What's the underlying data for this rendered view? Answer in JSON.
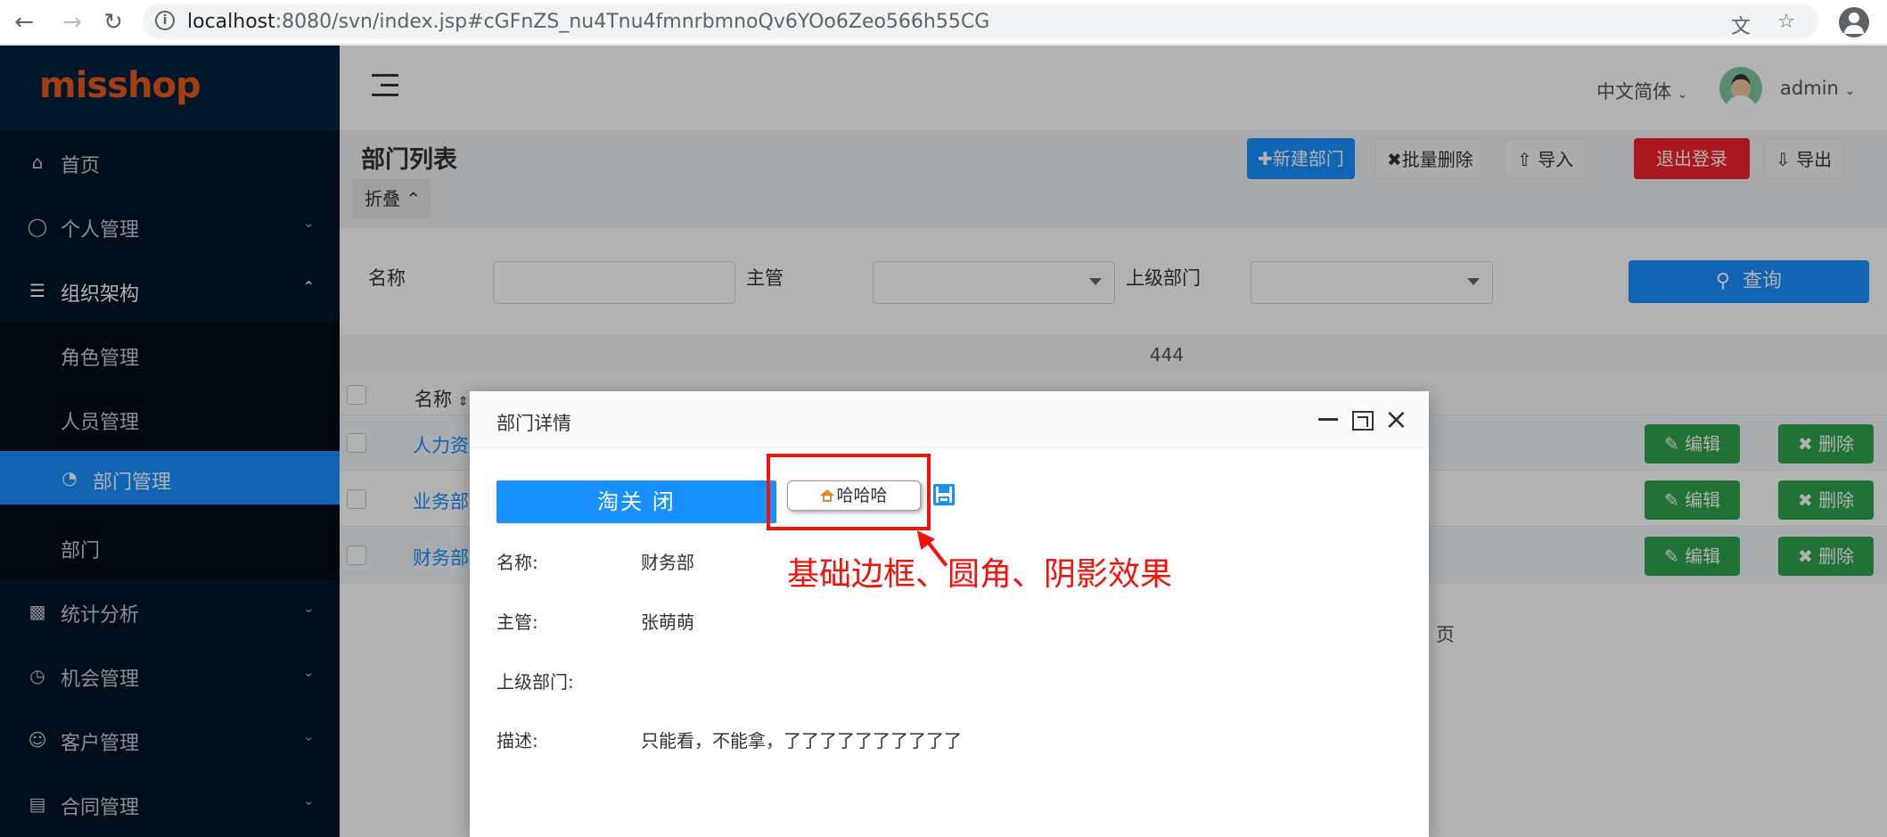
{
  "browser": {
    "url_host": "localhost",
    "url_rest": ":8080/svn/index.jsp#cGFnZS_nu4Tnu4fmnrbmnoQv6YOo6Zeo566h55CG"
  },
  "sidebar": {
    "logo": "misshop",
    "items": [
      {
        "label": "首页",
        "icon": "home-icon"
      },
      {
        "label": "个人管理",
        "icon": "user-icon"
      },
      {
        "label": "组织架构",
        "icon": "list-icon"
      },
      {
        "label": "角色管理"
      },
      {
        "label": "人员管理"
      },
      {
        "label": "部门管理",
        "icon": "pie-chart-icon"
      },
      {
        "label": "部门"
      },
      {
        "label": "统计分析",
        "icon": "bar-chart-icon"
      },
      {
        "label": "机会管理",
        "icon": "clock-icon"
      },
      {
        "label": "客户管理",
        "icon": "users-icon"
      },
      {
        "label": "合同管理",
        "icon": "contract-icon"
      }
    ]
  },
  "topbar": {
    "language": "中文简体",
    "username": "admin"
  },
  "page": {
    "title": "部门列表",
    "fold": "折叠",
    "buttons": {
      "new": "新建部门",
      "batch_delete": "批量删除",
      "import": "导入",
      "logout": "退出登录",
      "export": "导出"
    }
  },
  "filters": {
    "name_label": "名称",
    "manager_label": "主管",
    "parent_label": "上级部门",
    "query": "查询"
  },
  "table": {
    "count": "444",
    "header_name": "名称",
    "rows": [
      {
        "name": "人力资"
      },
      {
        "name": "业务部"
      },
      {
        "name": "财务部"
      }
    ],
    "edit": "编辑",
    "delete": "删除",
    "page_suffix": "页"
  },
  "modal": {
    "title": "部门详情",
    "close_button": "淘关 闭",
    "demo_button": "哈哈哈",
    "annotation": "基础边框、圆角、阴影效果",
    "fields": [
      {
        "label": "名称:",
        "value": "财务部"
      },
      {
        "label": "主管:",
        "value": "张萌萌"
      },
      {
        "label": "上级部门:",
        "value": ""
      },
      {
        "label": "描述:",
        "value": "只能看，不能拿，了了了了了了了了了了"
      }
    ]
  },
  "colors": {
    "primary": "#1890ff",
    "sidebar": "#001529",
    "success": "#2ea44f",
    "danger": "#f5222d",
    "annotation": "#f0140c",
    "logo": "#e85a1b"
  }
}
